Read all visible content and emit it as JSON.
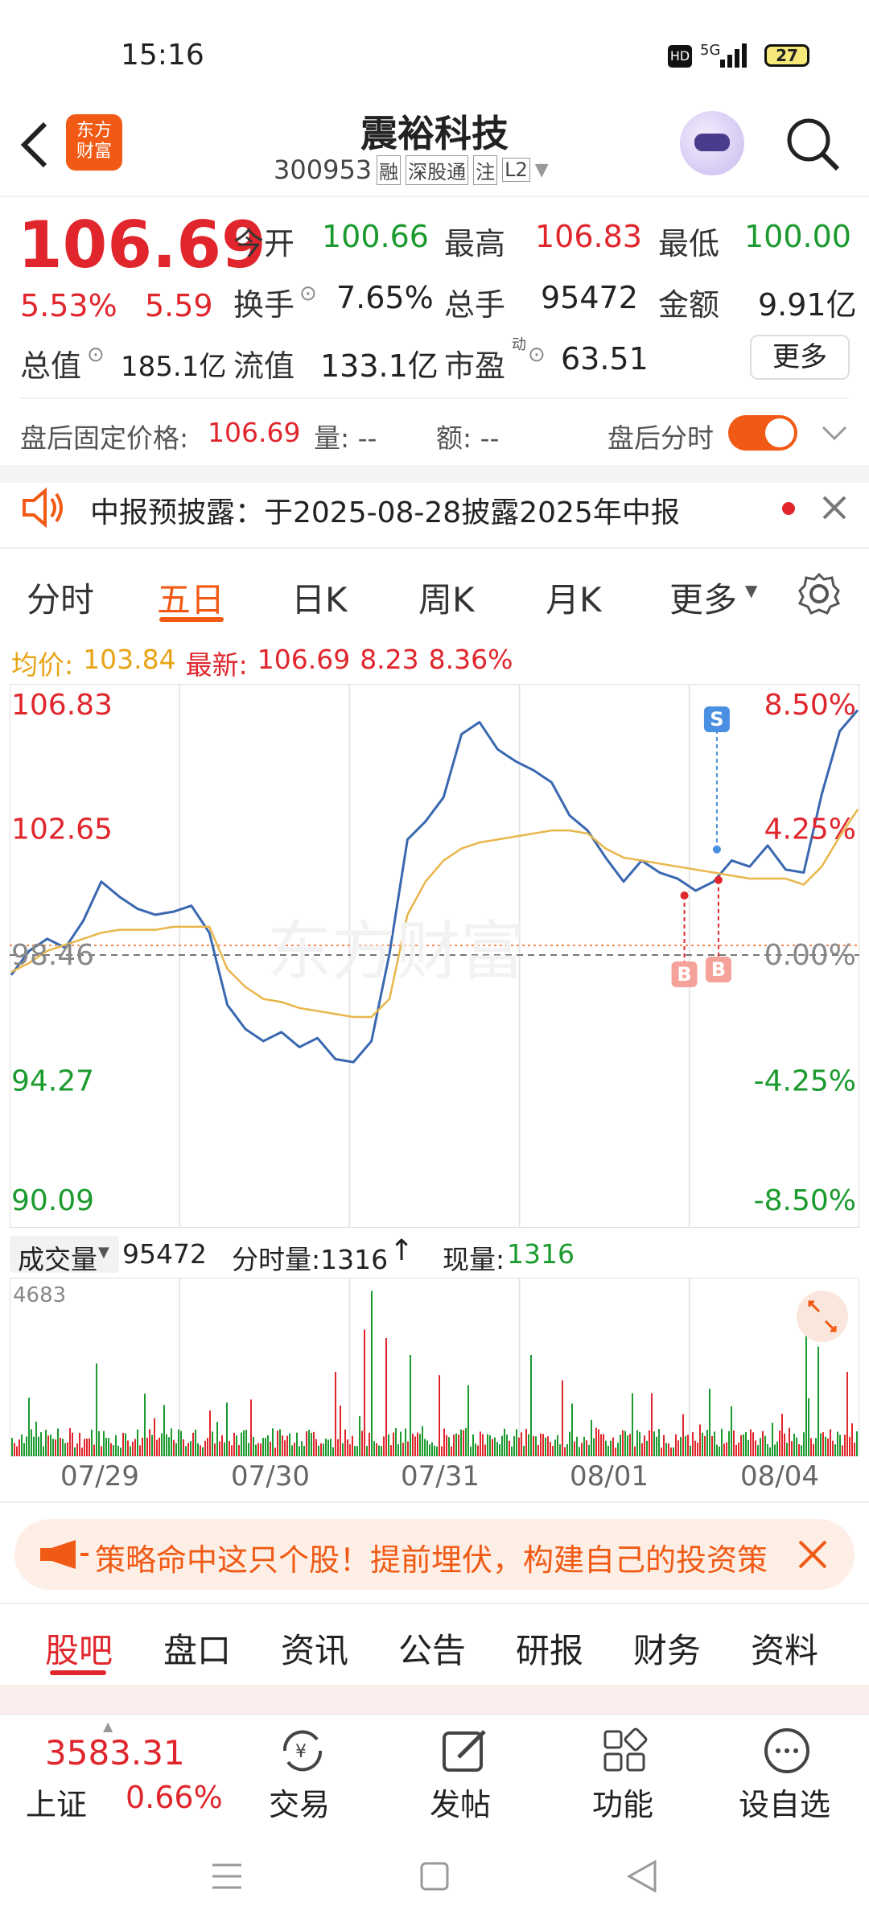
{
  "status_bar": {
    "time": "15:16",
    "network": "5G",
    "battery": "27"
  },
  "header": {
    "name": "震裕科技",
    "code": "300953",
    "badges": [
      "融",
      "深股通",
      "注",
      "L2"
    ],
    "logo_text_line1": "东方",
    "logo_text_line2": "财富"
  },
  "quote": {
    "price": "106.69",
    "change_pct": "5.53%",
    "change": "5.59",
    "open_label": "今开",
    "open": "100.66",
    "high_label": "最高",
    "high": "106.83",
    "low_label": "最低",
    "low": "100.00",
    "turnover_label": "换手",
    "turnover": "7.65%",
    "volume_label": "总手",
    "volume": "95472",
    "amount_label": "金额",
    "amount": "9.91亿",
    "mktcap_label": "总值",
    "mktcap": "185.1亿",
    "float_label": "流值",
    "float": "133.1亿",
    "pe_label": "市盈",
    "pe_sup": "动",
    "pe": "63.51",
    "more_btn": "更多"
  },
  "after_hours": {
    "price_label": "盘后固定价格:",
    "price": "106.69",
    "qty_label": "量: --",
    "amt_label": "额: --",
    "toggle_label": "盘后分时",
    "toggle_on": true
  },
  "notice": {
    "text": "中报预披露：于2025-08-28披露2025年中报"
  },
  "chart_tabs": [
    "分时",
    "五日",
    "日K",
    "周K",
    "月K",
    "更多"
  ],
  "active_tab": "五日",
  "chart_header": {
    "avg_label": "均价:",
    "avg": "103.84",
    "latest_label": "最新:",
    "latest": "106.69",
    "chg": "8.23",
    "chg_pct": "8.36%"
  },
  "chart_data": {
    "type": "line",
    "x_labels": [
      "07/29",
      "07/30",
      "07/31",
      "08/01",
      "08/04"
    ],
    "y_left_ticks": [
      "106.83",
      "102.65",
      "98.46",
      "94.27",
      "90.09"
    ],
    "y_right_ticks": [
      "8.50%",
      "4.25%",
      "0.00%",
      "-4.25%",
      "-8.50%"
    ],
    "ylim": [
      90.09,
      106.83
    ],
    "reference": 98.46,
    "series": [
      {
        "values": [
          97.8,
          98.6,
          99.0,
          98.7,
          99.6,
          100.9,
          100.4,
          100.0,
          99.8,
          99.9,
          100.1,
          99.2,
          96.8,
          96.0,
          95.6,
          95.9,
          95.4,
          95.7,
          95.0,
          94.9,
          95.6,
          98.5,
          102.3,
          102.9,
          103.7,
          105.8,
          106.2,
          105.3,
          104.9,
          104.6,
          104.2,
          103.1,
          102.6,
          101.7,
          100.9,
          101.6,
          101.2,
          101.0,
          100.6,
          100.9,
          101.6,
          101.4,
          102.1,
          101.3,
          101.2,
          103.8,
          105.9,
          106.6
        ]
      },
      {
        "values": [
          97.9,
          98.2,
          98.6,
          98.8,
          99.0,
          99.2,
          99.3,
          99.3,
          99.3,
          99.4,
          99.4,
          99.4,
          98.0,
          97.4,
          97.0,
          96.9,
          96.7,
          96.6,
          96.5,
          96.4,
          96.4,
          97.0,
          99.8,
          100.9,
          101.6,
          102.0,
          102.2,
          102.3,
          102.4,
          102.5,
          102.6,
          102.6,
          102.5,
          102.0,
          101.7,
          101.6,
          101.5,
          101.4,
          101.3,
          101.2,
          101.1,
          101.0,
          101.0,
          101.0,
          100.8,
          101.4,
          102.4,
          103.3
        ]
      }
    ]
  },
  "trade_marks": [
    "S",
    "B",
    "B"
  ],
  "watermark": "东方财富",
  "volume_header": {
    "label": "成交量",
    "total": "95472",
    "tick_label": "分时量:1316",
    "cur_label": "现量:",
    "cur": "1316"
  },
  "volume_data": {
    "max_label": "4683"
  },
  "promo": {
    "text": "策略命中这只个股！提前埋伏，构建自己的投资策"
  },
  "bottom_tabs": [
    "股吧",
    "盘口",
    "资讯",
    "公告",
    "研报",
    "财务",
    "资料"
  ],
  "active_bottom_tab": "股吧",
  "footer": {
    "index_value": "3583.31",
    "index_name": "上证",
    "index_chg": "0.66%",
    "actions": [
      "交易",
      "发帖",
      "功能",
      "设自选"
    ]
  }
}
